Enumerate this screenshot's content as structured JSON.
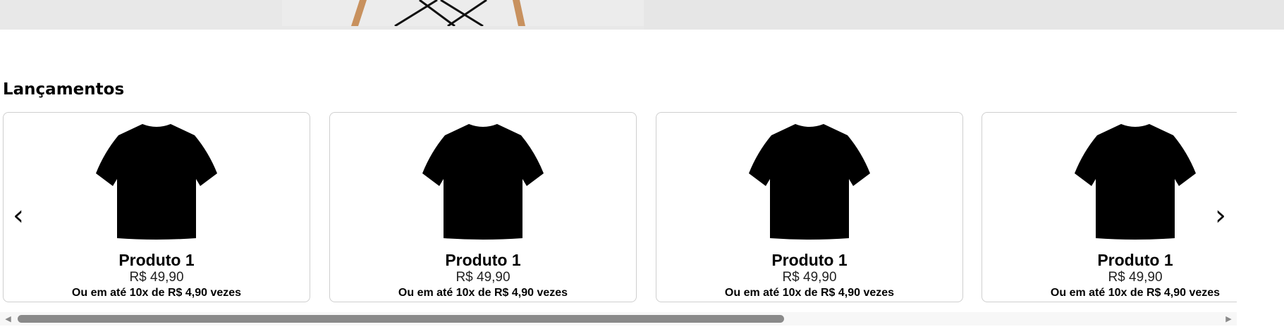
{
  "section": {
    "title": "Lançamentos"
  },
  "carousel": {
    "prev_icon": "‹",
    "next_icon": "›",
    "products": [
      {
        "name": "Produto 1",
        "price": "R$ 49,90",
        "installments": "Ou em até 10x de R$ 4,90 vezes",
        "image_icon": "tshirt-icon"
      },
      {
        "name": "Produto 1",
        "price": "R$ 49,90",
        "installments": "Ou em até 10x de R$ 4,90 vezes",
        "image_icon": "tshirt-icon"
      },
      {
        "name": "Produto 1",
        "price": "R$ 49,90",
        "installments": "Ou em até 10x de R$ 4,90 vezes",
        "image_icon": "tshirt-icon"
      },
      {
        "name": "Produto 1",
        "price": "R$ 49,90",
        "installments": "Ou em até 10x de R$ 4,90 vezes",
        "image_icon": "tshirt-icon"
      }
    ]
  },
  "scrollbar": {
    "left_icon": "◀",
    "right_icon": "▶"
  },
  "colors": {
    "hero_bg": "#e8e8e8",
    "card_border": "#cfcfcf",
    "scroll_thumb": "#8a8a8a"
  }
}
